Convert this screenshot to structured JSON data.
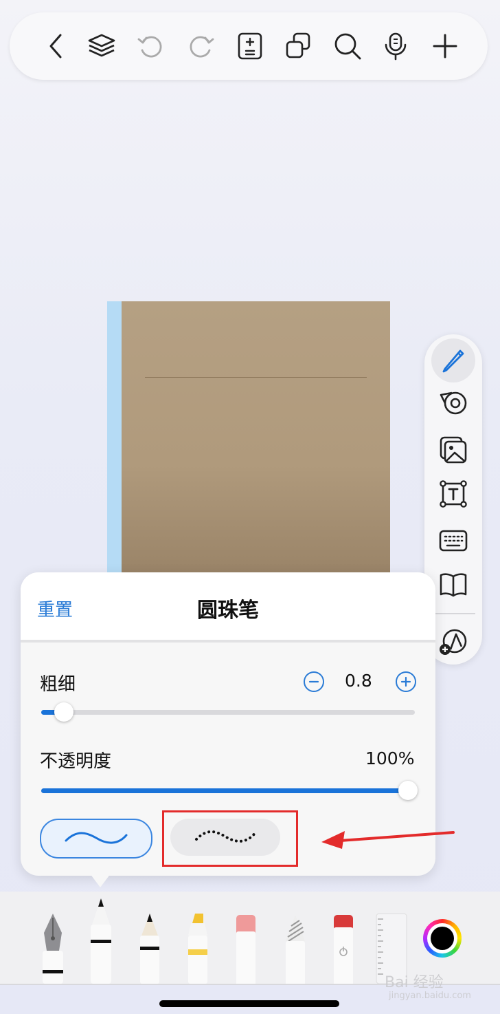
{
  "panel": {
    "reset_label": "重置",
    "title": "圆珠笔",
    "thickness": {
      "label": "粗细",
      "value": "0.8",
      "level": 0.06
    },
    "opacity": {
      "label": "不透明度",
      "value": "100%",
      "level": 1.0
    },
    "stroke_styles": [
      "solid",
      "dotted"
    ]
  },
  "top_toolbar": {
    "icons": [
      "back-icon",
      "layers-icon",
      "undo-icon",
      "redo-icon",
      "page-edit-icon",
      "copy-pages-icon",
      "search-icon",
      "microphone-icon",
      "add-icon"
    ]
  },
  "side_toolbar": {
    "icons": [
      "pen-icon",
      "tape-icon",
      "image-icon",
      "text-box-icon",
      "keyboard-icon",
      "book-icon",
      "shapes-icon"
    ],
    "active": "pen-icon"
  },
  "pen_toolbar": {
    "tools": [
      "fountain-pen",
      "ballpoint-pen",
      "pencil",
      "highlighter",
      "eraser",
      "brush-pen",
      "laser-pointer",
      "ruler"
    ],
    "selected": "ballpoint-pen"
  },
  "colors": {
    "accent": "#1a73d9",
    "highlight": "#e32b2b",
    "selected_color": "#000000"
  },
  "watermark": {
    "text": "Bai 经验",
    "sub": "jingyan.baidu.com"
  }
}
